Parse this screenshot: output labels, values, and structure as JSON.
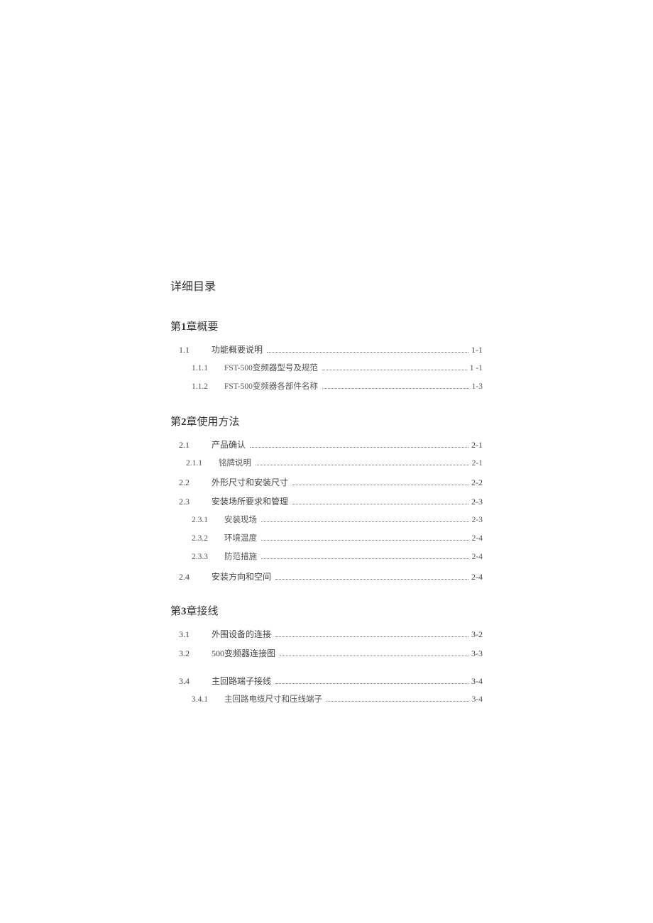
{
  "title": "详细目录",
  "chapters": [
    {
      "heading_prefix": "第",
      "heading_num": "1",
      "heading_suffix": "章概要",
      "items": [
        {
          "level": 1,
          "num": "1.1",
          "label": "功能概要说明",
          "page": "1-1"
        },
        {
          "level": 2,
          "num": "1.1.1",
          "label": "FST-500变频器型号及规范",
          "page": "1 -1"
        },
        {
          "level": 2,
          "num": "1.1.2",
          "label": "FST-500变频器各部件名称",
          "page": "1-3"
        }
      ]
    },
    {
      "heading_prefix": "第",
      "heading_num": "2",
      "heading_suffix": "章使用方法",
      "items": [
        {
          "level": 1,
          "num": "2.1",
          "label": "产品确认",
          "page": "2-1"
        },
        {
          "level": "2b",
          "num": "2.1.1",
          "label": "铭牌说明",
          "page": "2-1"
        },
        {
          "level": 1,
          "num": "2.2",
          "label": "外形尺寸和安装尺寸",
          "page": "2-2"
        },
        {
          "level": 1,
          "num": "2.3",
          "label": "安装场所要求和管理",
          "page": "2-3"
        },
        {
          "level": 2,
          "num": "2.3.1",
          "label": "安装现场",
          "page": "2-3"
        },
        {
          "level": 2,
          "num": "2.3.2",
          "label": "环境温度",
          "page": "2-4"
        },
        {
          "level": 2,
          "num": "2.3.3",
          "label": "防范措施",
          "page": "2-4"
        },
        {
          "level": 1,
          "num": "2.4",
          "label": "安装方向和空间",
          "page": "2-4"
        }
      ]
    },
    {
      "heading_prefix": "第",
      "heading_num": "3",
      "heading_suffix": "章接线",
      "items": [
        {
          "level": 1,
          "num": "3.1",
          "label": "外围设备的连接",
          "page": "3-2"
        },
        {
          "level": 1,
          "num": "3.2",
          "label": "500变频器连接图",
          "page": "3-3"
        },
        {
          "level": "gap"
        },
        {
          "level": 1,
          "num": "3.4",
          "label": "主回路端子接线",
          "page": "3-4"
        },
        {
          "level": 2,
          "num": "3.4.1",
          "label": "主回路电缆尺寸和压线端子",
          "page": "3-4"
        }
      ]
    }
  ]
}
